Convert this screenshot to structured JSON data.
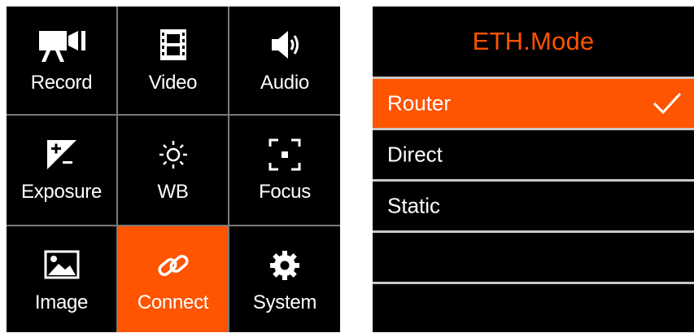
{
  "grid": {
    "items": [
      {
        "label": "Record",
        "icon": "video-camera-icon",
        "active": false
      },
      {
        "label": "Video",
        "icon": "film-strip-icon",
        "active": false
      },
      {
        "label": "Audio",
        "icon": "speaker-icon",
        "active": false
      },
      {
        "label": "Exposure",
        "icon": "exposure-compensation-icon",
        "active": false
      },
      {
        "label": "WB",
        "icon": "sun-icon",
        "active": false
      },
      {
        "label": "Focus",
        "icon": "focus-frame-icon",
        "active": false
      },
      {
        "label": "Image",
        "icon": "picture-icon",
        "active": false
      },
      {
        "label": "Connect",
        "icon": "link-icon",
        "active": true
      },
      {
        "label": "System",
        "icon": "gear-icon",
        "active": false
      }
    ]
  },
  "panel": {
    "title": "ETH.Mode",
    "items": [
      {
        "label": "Router",
        "selected": true
      },
      {
        "label": "Direct",
        "selected": false
      },
      {
        "label": "Static",
        "selected": false
      },
      {
        "label": "",
        "selected": false
      },
      {
        "label": "",
        "selected": false
      }
    ]
  },
  "colors": {
    "accent": "#ff5400",
    "background": "#000000",
    "separator": "#c8c8c8",
    "text": "#ffffff"
  }
}
